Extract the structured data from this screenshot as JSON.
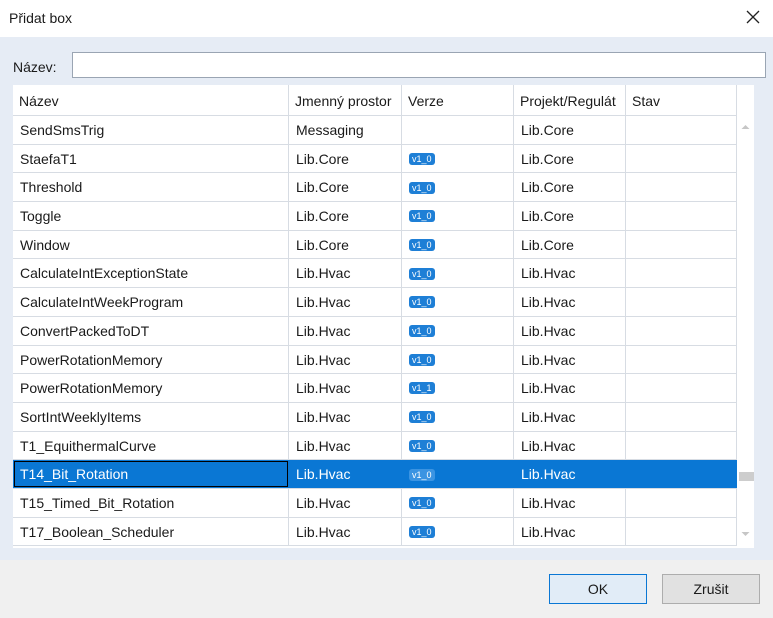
{
  "dialog": {
    "title": "Přidat box"
  },
  "search": {
    "label": "Název:",
    "value": ""
  },
  "columns": [
    "Název",
    "Jmenný prostor",
    "Verze",
    "Projekt/Regulát",
    "Stav"
  ],
  "rows": [
    {
      "name": "SendSmsTrig",
      "namespace": "Messaging",
      "version": "",
      "project": "Lib.Core",
      "status": ""
    },
    {
      "name": "StaefaT1",
      "namespace": "Lib.Core",
      "version": "v1_0",
      "project": "Lib.Core",
      "status": ""
    },
    {
      "name": "Threshold",
      "namespace": "Lib.Core",
      "version": "v1_0",
      "project": "Lib.Core",
      "status": ""
    },
    {
      "name": "Toggle",
      "namespace": "Lib.Core",
      "version": "v1_0",
      "project": "Lib.Core",
      "status": ""
    },
    {
      "name": "Window",
      "namespace": "Lib.Core",
      "version": "v1_0",
      "project": "Lib.Core",
      "status": ""
    },
    {
      "name": "CalculateIntExceptionState",
      "namespace": "Lib.Hvac",
      "version": "v1_0",
      "project": "Lib.Hvac",
      "status": ""
    },
    {
      "name": "CalculateIntWeekProgram",
      "namespace": "Lib.Hvac",
      "version": "v1_0",
      "project": "Lib.Hvac",
      "status": ""
    },
    {
      "name": "ConvertPackedToDT",
      "namespace": "Lib.Hvac",
      "version": "v1_0",
      "project": "Lib.Hvac",
      "status": ""
    },
    {
      "name": "PowerRotationMemory",
      "namespace": "Lib.Hvac",
      "version": "v1_0",
      "project": "Lib.Hvac",
      "status": ""
    },
    {
      "name": "PowerRotationMemory",
      "namespace": "Lib.Hvac",
      "version": "v1_1",
      "project": "Lib.Hvac",
      "status": ""
    },
    {
      "name": "SortIntWeeklyItems",
      "namespace": "Lib.Hvac",
      "version": "v1_0",
      "project": "Lib.Hvac",
      "status": ""
    },
    {
      "name": "T1_EquithermalCurve",
      "namespace": "Lib.Hvac",
      "version": "v1_0",
      "project": "Lib.Hvac",
      "status": ""
    },
    {
      "name": "T14_Bit_Rotation",
      "namespace": "Lib.Hvac",
      "version": "v1_0",
      "project": "Lib.Hvac",
      "status": "",
      "selected": true
    },
    {
      "name": "T15_Timed_Bit_Rotation",
      "namespace": "Lib.Hvac",
      "version": "v1_0",
      "project": "Lib.Hvac",
      "status": ""
    },
    {
      "name": "T17_Boolean_Scheduler",
      "namespace": "Lib.Hvac",
      "version": "v1_0",
      "project": "Lib.Hvac",
      "status": ""
    }
  ],
  "buttons": {
    "ok": "OK",
    "cancel": "Zrušit"
  },
  "colors": {
    "selection": "#0a77d4",
    "badge": "#1e7fd6",
    "content_bg": "#e6ecf5"
  }
}
